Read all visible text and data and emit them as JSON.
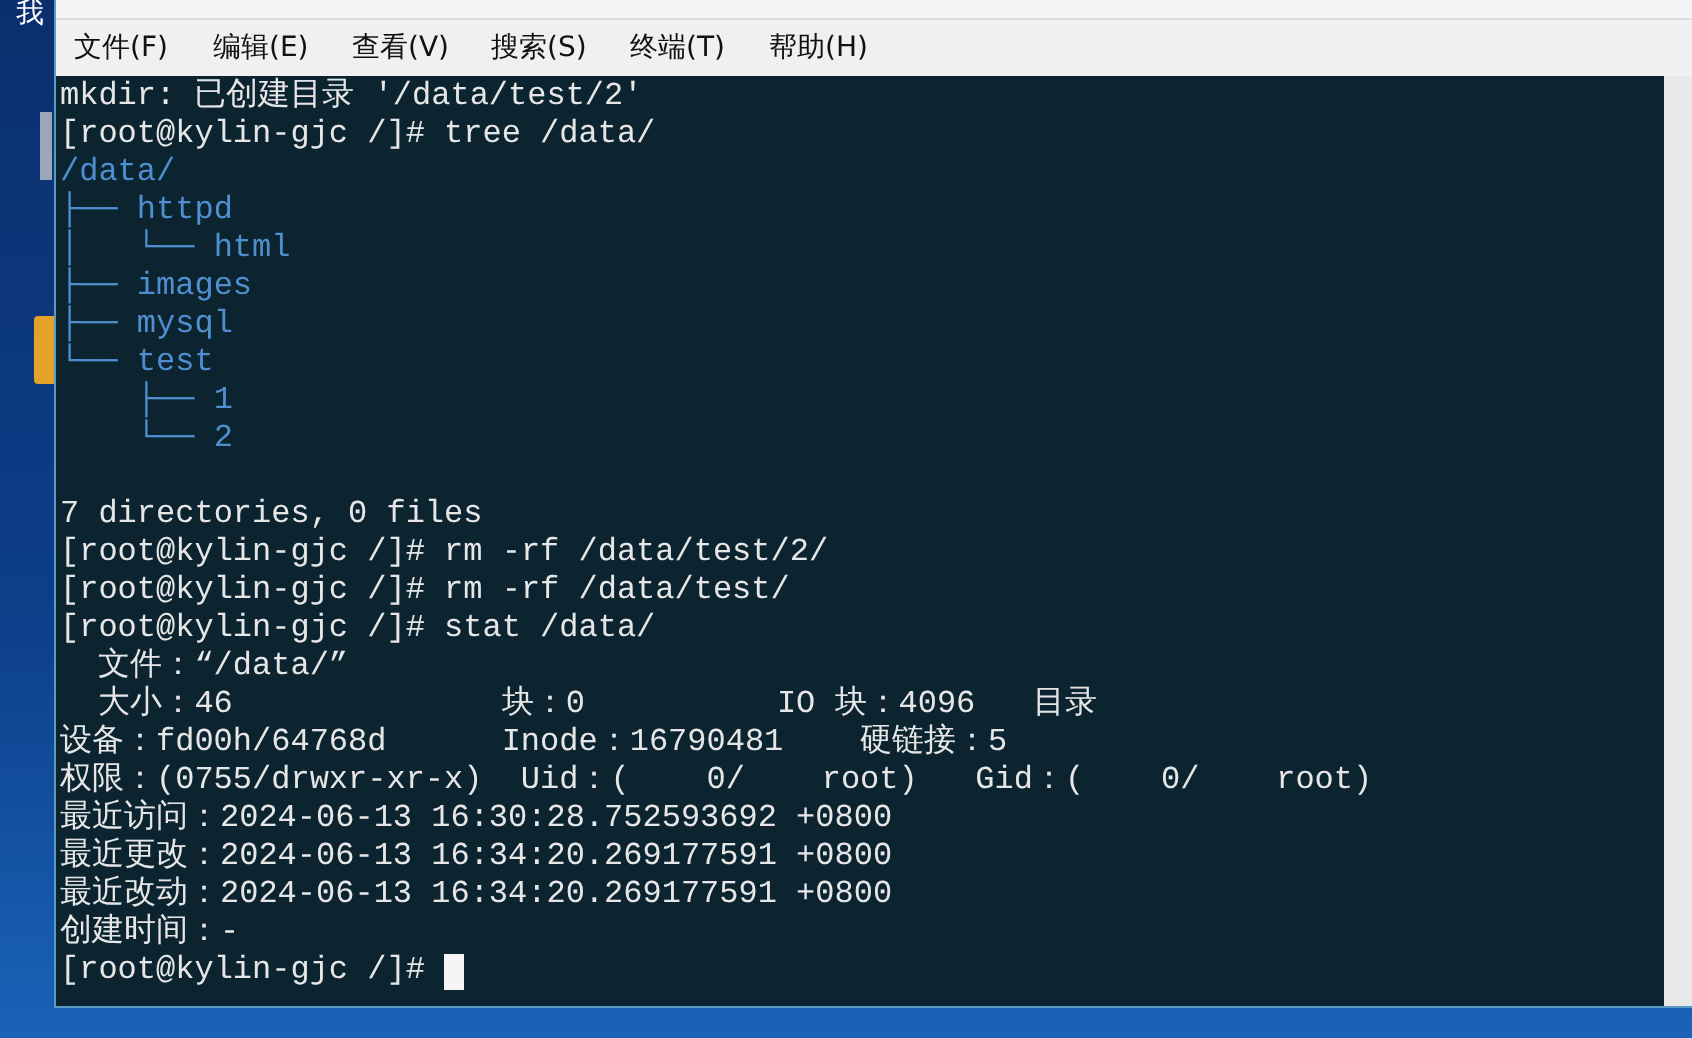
{
  "desktop": {
    "icon_labels": [
      "我"
    ]
  },
  "menu": [
    "文件(F)",
    "编辑(E)",
    "查看(V)",
    "搜索(S)",
    "终端(T)",
    "帮助(H)"
  ],
  "terminal": {
    "lines": [
      {
        "kind": "text",
        "text": "mkdir: 已创建目录 '/data/test/2'"
      },
      {
        "kind": "text",
        "text": "[root@kylin-gjc /]# tree /data/"
      },
      {
        "kind": "dir",
        "text": "/data/"
      },
      {
        "kind": "dir",
        "text": "├── httpd"
      },
      {
        "kind": "dir",
        "text": "│   └── html"
      },
      {
        "kind": "dir",
        "text": "├── images"
      },
      {
        "kind": "dir",
        "text": "├── mysql"
      },
      {
        "kind": "dir",
        "text": "└── test"
      },
      {
        "kind": "dir",
        "text": "    ├── 1"
      },
      {
        "kind": "dir",
        "text": "    └── 2"
      },
      {
        "kind": "blank"
      },
      {
        "kind": "text",
        "text": "7 directories, 0 files"
      },
      {
        "kind": "text",
        "text": "[root@kylin-gjc /]# rm -rf /data/test/2/"
      },
      {
        "kind": "text",
        "text": "[root@kylin-gjc /]# rm -rf /data/test/"
      },
      {
        "kind": "text",
        "text": "[root@kylin-gjc /]# stat /data/"
      },
      {
        "kind": "text",
        "text": "  文件：“/data/”"
      },
      {
        "kind": "text",
        "text": "  大小：46              块：0          IO 块：4096   目录"
      },
      {
        "kind": "text",
        "text": "设备：fd00h/64768d      Inode：16790481    硬链接：5"
      },
      {
        "kind": "text",
        "text": "权限：(0755/drwxr-xr-x)  Uid：(    0/    root)   Gid：(    0/    root)"
      },
      {
        "kind": "text",
        "text": "最近访问：2024-06-13 16:30:28.752593692 +0800"
      },
      {
        "kind": "text",
        "text": "最近更改：2024-06-13 16:34:20.269177591 +0800"
      },
      {
        "kind": "text",
        "text": "最近改动：2024-06-13 16:34:20.269177591 +0800"
      },
      {
        "kind": "text",
        "text": "创建时间：-"
      },
      {
        "kind": "prompt",
        "text": "[root@kylin-gjc /]# "
      }
    ]
  }
}
